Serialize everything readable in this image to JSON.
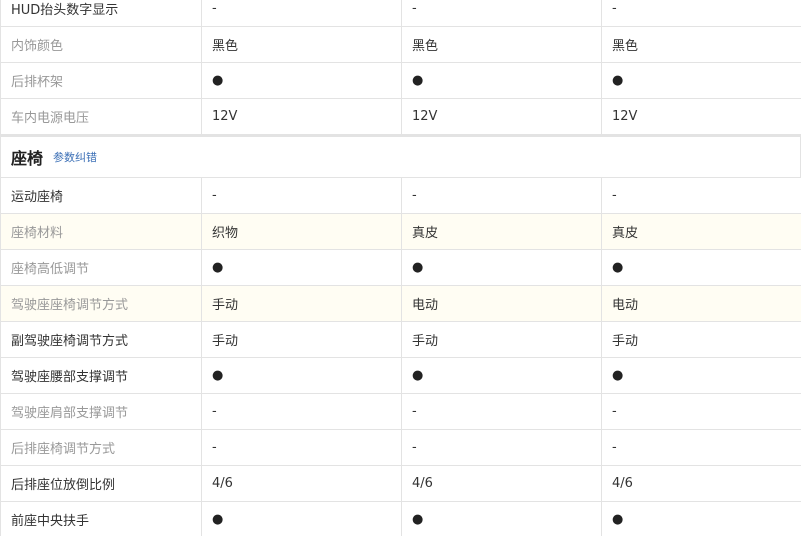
{
  "top_rows": [
    {
      "label": "HUD抬头数字显示",
      "tone": "dark",
      "values": [
        "-",
        "-",
        "-"
      ],
      "highlight": false
    },
    {
      "label": "内饰颜色",
      "tone": "grey",
      "values": [
        "黑色",
        "黑色",
        "黑色"
      ],
      "highlight": false
    },
    {
      "label": "后排杯架",
      "tone": "grey",
      "values": [
        "●",
        "●",
        "●"
      ],
      "highlight": false
    },
    {
      "label": "车内电源电压",
      "tone": "grey",
      "values": [
        "12V",
        "12V",
        "12V"
      ],
      "highlight": false
    }
  ],
  "section": {
    "title": "座椅",
    "link": "参数纠错"
  },
  "seat_rows": [
    {
      "label": "运动座椅",
      "tone": "dark",
      "values": [
        "-",
        "-",
        "-"
      ],
      "highlight": false
    },
    {
      "label": "座椅材料",
      "tone": "grey",
      "values": [
        "织物",
        "真皮",
        "真皮"
      ],
      "highlight": true
    },
    {
      "label": "座椅高低调节",
      "tone": "grey",
      "values": [
        "●",
        "●",
        "●"
      ],
      "highlight": false
    },
    {
      "label": "驾驶座座椅调节方式",
      "tone": "grey",
      "values": [
        "手动",
        "电动",
        "电动"
      ],
      "highlight": true
    },
    {
      "label": "副驾驶座椅调节方式",
      "tone": "dark",
      "values": [
        "手动",
        "手动",
        "手动"
      ],
      "highlight": false
    },
    {
      "label": "驾驶座腰部支撑调节",
      "tone": "dark",
      "values": [
        "●",
        "●",
        "●"
      ],
      "highlight": false
    },
    {
      "label": "驾驶座肩部支撑调节",
      "tone": "grey",
      "values": [
        "-",
        "-",
        "-"
      ],
      "highlight": false
    },
    {
      "label": "后排座椅调节方式",
      "tone": "grey",
      "values": [
        "-",
        "-",
        "-"
      ],
      "highlight": false
    },
    {
      "label": "后排座位放倒比例",
      "tone": "dark",
      "values": [
        "4/6",
        "4/6",
        "4/6"
      ],
      "highlight": false
    },
    {
      "label": "前座中央扶手",
      "tone": "dark",
      "values": [
        "●",
        "●",
        "●"
      ],
      "highlight": false
    }
  ],
  "colors": {
    "border": "#e3e3e3",
    "label_grey": "#999999",
    "text": "#333333",
    "highlight_bg": "#fffdf3",
    "link": "#3b6fb6"
  }
}
